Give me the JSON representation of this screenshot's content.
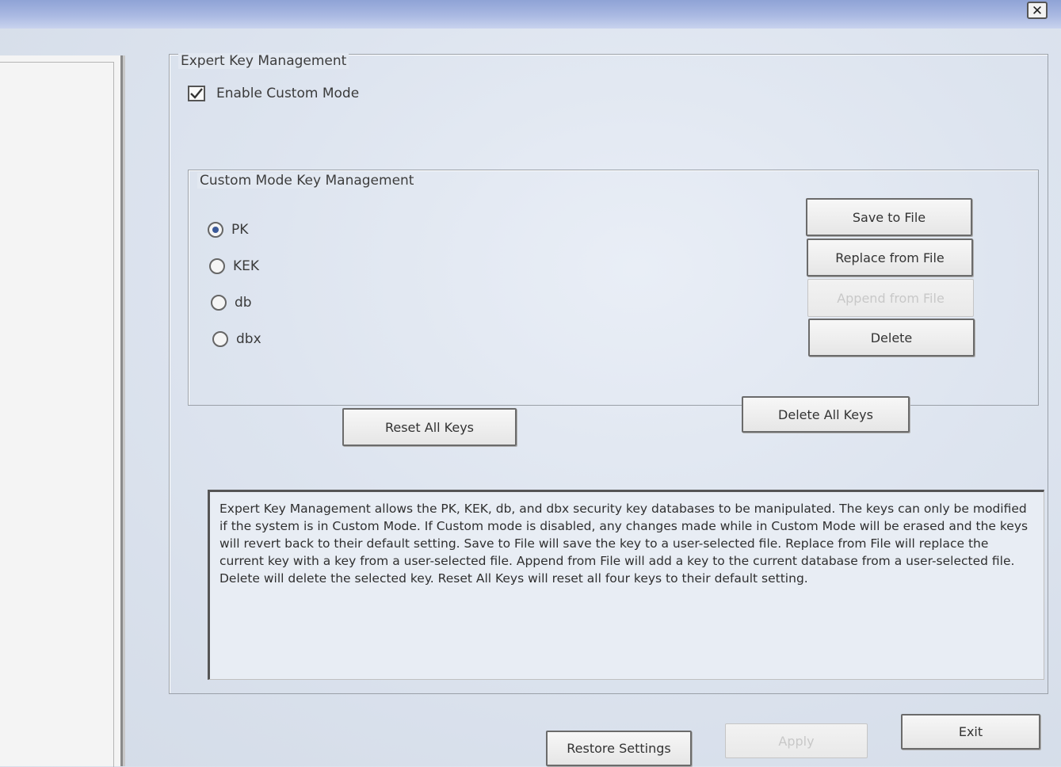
{
  "window": {
    "close_glyph": "✕"
  },
  "expert": {
    "legend": "Expert Key Management",
    "enable_label": "Enable Custom Mode",
    "enable_checked": true
  },
  "custom": {
    "legend": "Custom Mode Key Management",
    "radios": [
      {
        "label": "PK",
        "checked": true
      },
      {
        "label": "KEK",
        "checked": false
      },
      {
        "label": "db",
        "checked": false
      },
      {
        "label": "dbx",
        "checked": false
      }
    ],
    "buttons": {
      "save": "Save to File",
      "replace": "Replace from File",
      "append": "Append from File",
      "delete": "Delete"
    }
  },
  "actions": {
    "reset_all": "Reset All Keys",
    "delete_all": "Delete All Keys"
  },
  "description": "Expert Key Management allows the PK, KEK, db, and dbx security key databases to be manipulated. The keys can only be modified if the system is in Custom Mode. If Custom mode is disabled, any changes made while in Custom Mode will be erased and the keys will revert back to their default setting. Save to File will save the key to a user-selected file. Replace from File will replace the current key with a key from a user-selected file. Append from File will add a key to the current database from a user-selected file. Delete will delete the selected key. Reset All Keys will reset all four keys to their default setting.",
  "footer": {
    "restore": "Restore Settings",
    "apply": "Apply",
    "exit": "Exit"
  }
}
